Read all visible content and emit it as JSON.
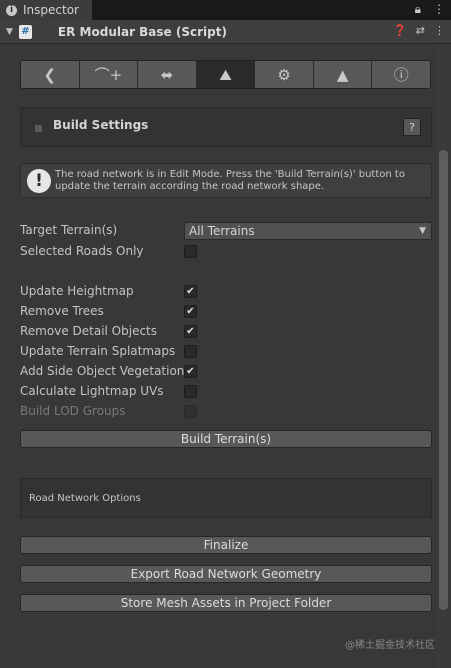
{
  "tab": {
    "title": "Inspector",
    "icon": "info-icon",
    "right_icons": [
      "lock-icon",
      "kebab-menu-icon"
    ]
  },
  "component": {
    "title": "ER Modular Base (Script)",
    "fold_icon": "foldout-arrow-icon",
    "script_icon": "csharp-script-icon",
    "header_icons": [
      "help-icon",
      "preset-icon",
      "kebab-menu-icon"
    ]
  },
  "toolbar": {
    "tools": [
      {
        "name": "back",
        "icon": "back-arrow-icon",
        "glyph": "❮",
        "active": false
      },
      {
        "name": "add-road",
        "icon": "road-add-icon",
        "glyph": "⌒+",
        "active": false
      },
      {
        "name": "connection",
        "icon": "connection-icon",
        "glyph": "⬌",
        "active": false
      },
      {
        "name": "terrain",
        "icon": "terrain-icon",
        "glyph": "⛰",
        "active": true
      },
      {
        "name": "settings",
        "icon": "gear-icon",
        "glyph": "⚙",
        "active": false
      },
      {
        "name": "object",
        "icon": "object-icon",
        "glyph": "▲",
        "active": false
      },
      {
        "name": "info",
        "icon": "info-icon",
        "glyph": "ⓘ",
        "active": false
      }
    ]
  },
  "build_settings": {
    "label": "Build Settings",
    "help": "?"
  },
  "info_message": "The road network is in Edit Mode. Press the 'Build Terrain(s)' button to update the terrain according the road network shape.",
  "fields": {
    "target_terrain": {
      "label": "Target Terrain(s)",
      "value": "All Terrains"
    },
    "selected_roads_only": {
      "label": "Selected Roads Only",
      "checked": false
    },
    "update_heightmap": {
      "label": "Update Heightmap",
      "checked": true
    },
    "remove_trees": {
      "label": "Remove Trees",
      "checked": true
    },
    "remove_detail_objects": {
      "label": "Remove Detail Objects",
      "checked": true
    },
    "update_splatmaps": {
      "label": "Update Terrain Splatmaps",
      "checked": false
    },
    "add_side_vegetation": {
      "label": "Add Side Object Vegetation",
      "checked": true
    },
    "calculate_lightmap_uvs": {
      "label": "Calculate Lightmap UVs",
      "checked": false
    },
    "build_lod_groups": {
      "label": "Build LOD Groups",
      "checked": false,
      "disabled": true
    }
  },
  "buttons": {
    "build_terrain": "Build Terrain(s)",
    "finalize": "Finalize",
    "export_geometry": "Export Road Network Geometry",
    "store_mesh_assets": "Store Mesh Assets in Project Folder"
  },
  "road_network_options": {
    "label": "Road Network Options"
  },
  "watermark": "@稀土掘金技术社区",
  "colors": {
    "background": "#383838",
    "button": "#585858",
    "active_tool": "#2b2b2b"
  }
}
